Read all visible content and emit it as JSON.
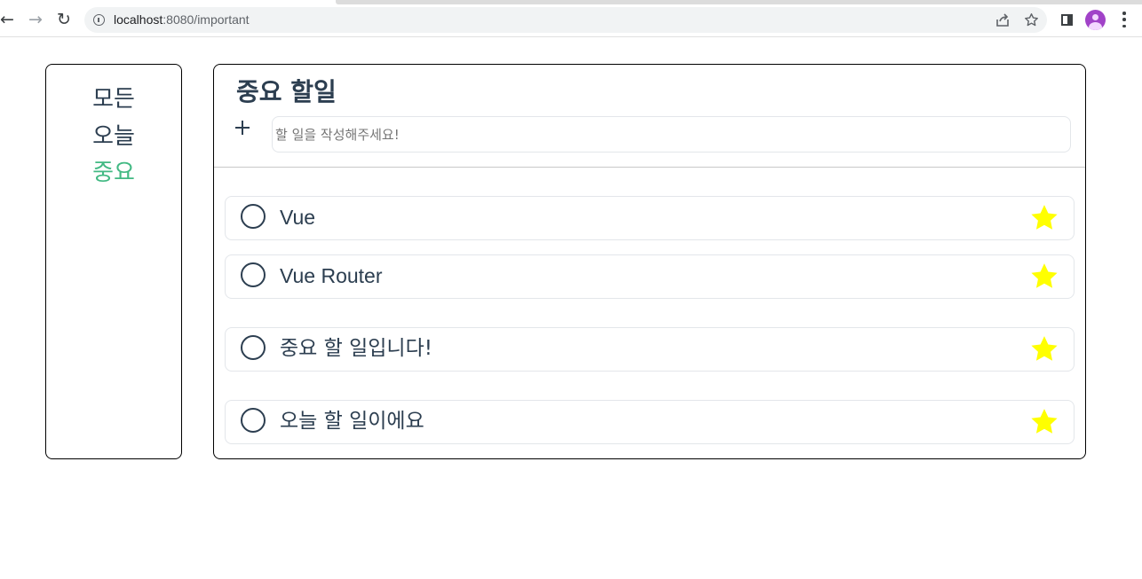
{
  "browser": {
    "url_host": "localhost",
    "url_path": ":8080/important"
  },
  "sidebar": {
    "items": [
      {
        "label": "모든",
        "active": false
      },
      {
        "label": "오늘",
        "active": false
      },
      {
        "label": "중요",
        "active": true
      }
    ]
  },
  "main": {
    "title": "중요 할일",
    "add_icon": "plus-icon",
    "input": {
      "value": "",
      "placeholder": "할 일을 작성해주세요!"
    },
    "todos": [
      {
        "text": "Vue",
        "done": false,
        "important": true
      },
      {
        "text": "Vue Router",
        "done": false,
        "important": true
      },
      {
        "text": "중요 할 일입니다!",
        "done": false,
        "important": true
      },
      {
        "text": "오늘 할 일이에요",
        "done": false,
        "important": true
      }
    ]
  },
  "colors": {
    "active_link": "#42b983",
    "text": "#2c3e50",
    "star": "#ffff00",
    "avatar": "#a142c8"
  }
}
